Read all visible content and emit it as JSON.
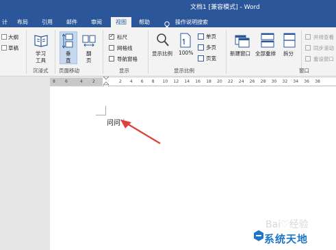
{
  "window": {
    "title": "文档1 [兼容模式] - Word"
  },
  "tabs": [
    {
      "label": "计"
    },
    {
      "label": "布局"
    },
    {
      "label": "引用"
    },
    {
      "label": "邮件"
    },
    {
      "label": "审阅"
    },
    {
      "label": "视图"
    },
    {
      "label": "帮助"
    },
    {
      "label": "操作说明搜索"
    }
  ],
  "ribbon": {
    "views": {
      "outline": "大纲",
      "draft": "草稿"
    },
    "immersive": {
      "learning_tools_1": "学习",
      "learning_tools_2": "工具",
      "group": "沉浸式"
    },
    "page_movement": {
      "vertical_1": "垂",
      "vertical_2": "直",
      "flip_1": "翻",
      "flip_2": "页",
      "group": "页面移动"
    },
    "show": {
      "ruler": "标尺",
      "gridlines": "网格线",
      "nav_pane": "导航窗格",
      "group": "显示"
    },
    "zoom": {
      "zoom": "显示比例",
      "hundred": "100%",
      "single": "单页",
      "multi": "多页",
      "width": "页宽",
      "group": "显示比例"
    },
    "window": {
      "new_window": "新建窗口",
      "arrange_all": "全部重排",
      "split": "拆分",
      "side_by_side": "并排查看",
      "sync_scroll": "同步滚动",
      "reset_pos": "重设窗口",
      "group": "窗口"
    }
  },
  "ruler": {
    "numbers": [
      "8",
      "6",
      "4",
      "2",
      "2",
      "4",
      "6",
      "8",
      "10",
      "12",
      "14",
      "16",
      "18",
      "20",
      "22",
      "24",
      "26",
      "28",
      "30",
      "32",
      "34",
      "36",
      "38"
    ]
  },
  "document": {
    "text": "问问",
    "paragraph_mark": "↵"
  },
  "watermark": {
    "brand": "系统天地",
    "baidu": "Bai♡经验"
  },
  "colors": {
    "accent": "#2b579a",
    "arrow": "#e0403c",
    "watermark": "#1e76c9"
  }
}
